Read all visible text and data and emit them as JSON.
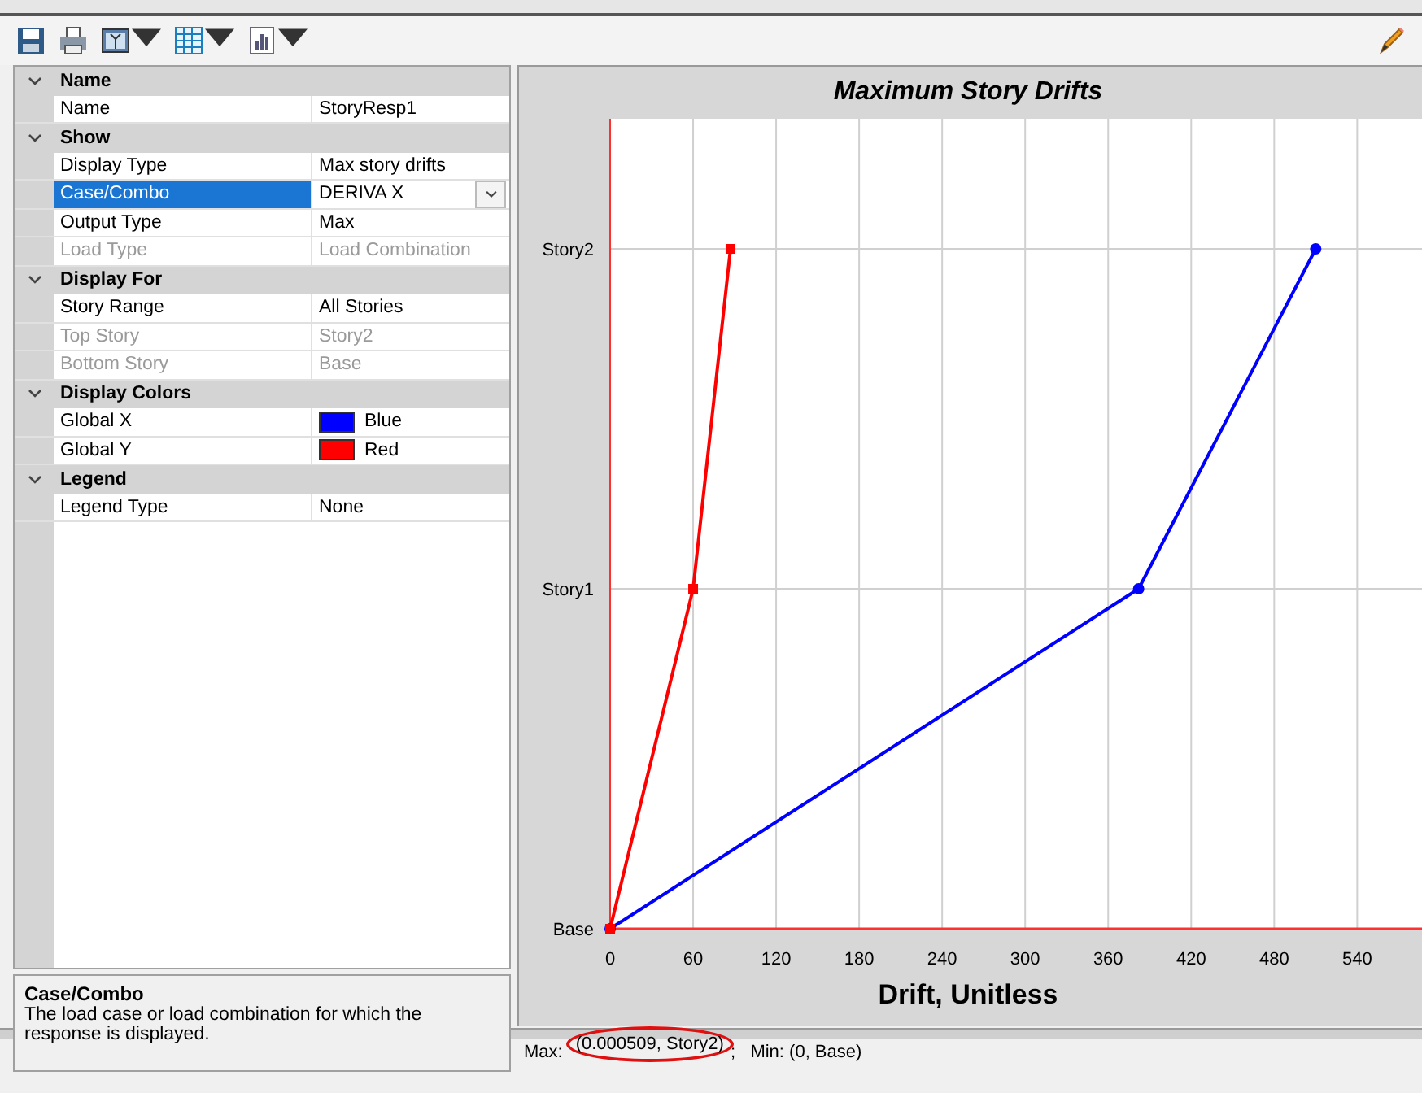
{
  "toolbar": {
    "buttons": [
      {
        "kind": "save",
        "dropdown": false
      },
      {
        "kind": "print",
        "dropdown": false
      },
      {
        "kind": "picture",
        "dropdown": true
      },
      {
        "kind": "table",
        "dropdown": true
      },
      {
        "kind": "chart",
        "dropdown": true
      }
    ],
    "right_button": {
      "kind": "pencil"
    }
  },
  "property_grid": {
    "categories": [
      {
        "title": "Name",
        "expanded": true,
        "rows": [
          {
            "kind": "text",
            "label": "Name",
            "value": "StoryResp1",
            "disabled": false,
            "selected": false
          }
        ]
      },
      {
        "title": "Show",
        "expanded": true,
        "rows": [
          {
            "kind": "text",
            "label": "Display Type",
            "value": "Max story drifts",
            "disabled": false,
            "selected": false
          },
          {
            "kind": "dropdown",
            "label": "Case/Combo",
            "value": "DERIVA X",
            "disabled": false,
            "selected": true
          },
          {
            "kind": "text",
            "label": "Output Type",
            "value": "Max",
            "disabled": false,
            "selected": false
          },
          {
            "kind": "text",
            "label": "Load Type",
            "value": "Load Combination",
            "disabled": true,
            "selected": false
          }
        ]
      },
      {
        "title": "Display For",
        "expanded": true,
        "rows": [
          {
            "kind": "text",
            "label": "Story Range",
            "value": "All Stories",
            "disabled": false,
            "selected": false
          },
          {
            "kind": "text",
            "label": "Top Story",
            "value": "Story2",
            "disabled": true,
            "selected": false
          },
          {
            "kind": "text",
            "label": "Bottom Story",
            "value": "Base",
            "disabled": true,
            "selected": false
          }
        ]
      },
      {
        "title": "Display Colors",
        "expanded": true,
        "rows": [
          {
            "kind": "color",
            "label": "Global X",
            "value": "Blue",
            "color": "#0000ff",
            "disabled": false,
            "selected": false
          },
          {
            "kind": "color",
            "label": "Global Y",
            "value": "Red",
            "color": "#ff0000",
            "disabled": false,
            "selected": false
          }
        ]
      },
      {
        "title": "Legend",
        "expanded": true,
        "rows": [
          {
            "kind": "text",
            "label": "Legend Type",
            "value": "None",
            "disabled": false,
            "selected": false
          }
        ]
      }
    ]
  },
  "description": {
    "title": "Case/Combo",
    "text": "The load case or load combination for which the response is displayed."
  },
  "chart": {
    "chart_data": {
      "type": "line",
      "orientation": "horizontal",
      "title": "Maximum Story Drifts",
      "xlabel": "Drift, Unitless",
      "categories": [
        "Story2",
        "Story1",
        "Base"
      ],
      "grid": true,
      "series": [
        {
          "color": "#0000ff",
          "marker": "circle",
          "values": [
            510,
            382,
            0
          ]
        },
        {
          "color": "#ff0000",
          "marker": "square",
          "values": [
            87,
            60,
            0
          ]
        }
      ],
      "xlim": [
        0,
        588
      ],
      "xticks": [
        0,
        60,
        120,
        180,
        240,
        300,
        360,
        420,
        480,
        540
      ]
    }
  },
  "status_bar": {
    "max_label": "Max:",
    "max_value": "(0.000509, Story2)",
    "max_circled": true,
    "separator": ";",
    "min": "Min: (0, Base)"
  }
}
